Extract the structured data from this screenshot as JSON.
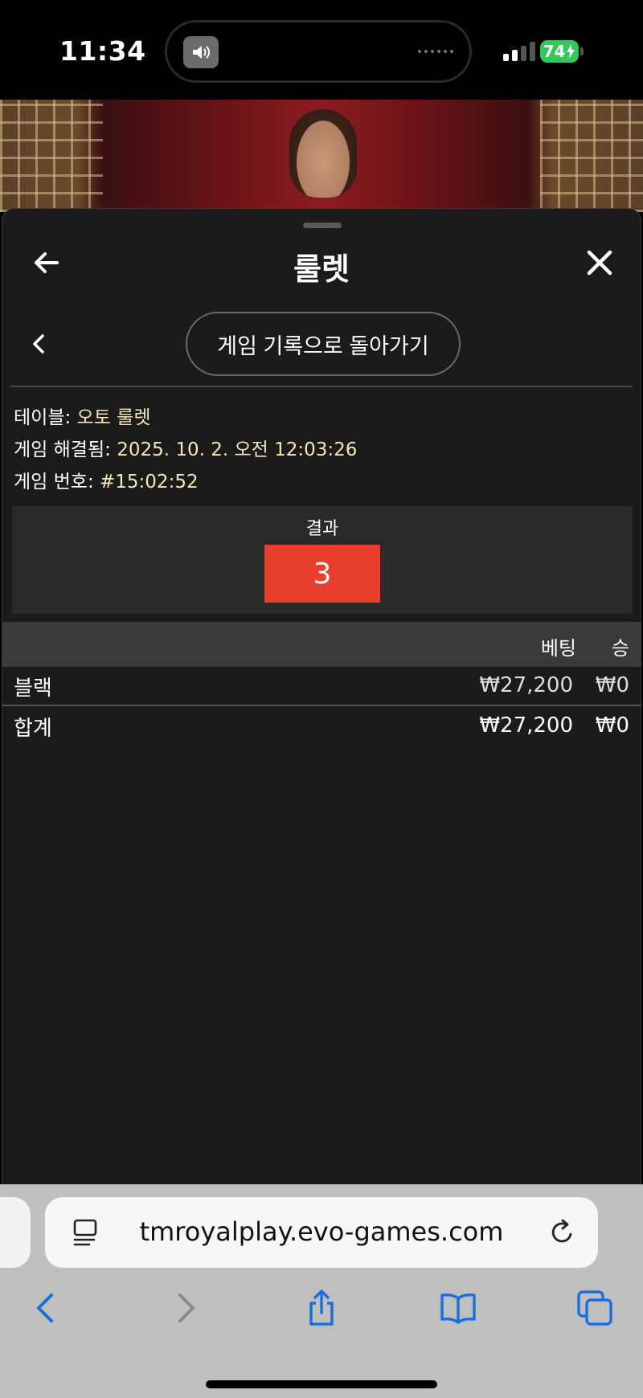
{
  "status_bar": {
    "time": "11:34",
    "battery": "74",
    "icons": [
      "speaker-icon",
      "signal-icon",
      "battery-charging-icon"
    ]
  },
  "header": {
    "title": "룰렛",
    "icons": [
      "back-arrow-icon",
      "close-icon"
    ]
  },
  "sub_nav": {
    "history_button": "게임 기록으로 돌아가기",
    "icons": [
      "chevron-left-icon"
    ]
  },
  "info": {
    "table_label": "테이블:",
    "table_value": "오토 룰렛",
    "resolved_label": "게임 해결됨:",
    "resolved_value": "2025. 10. 2. 오전 12:03:26",
    "game_no_label": "게임 번호:",
    "game_no_value": "#15:02:52"
  },
  "result": {
    "label": "결과",
    "number": "3",
    "color": "#e83e2e"
  },
  "table": {
    "col_bet": "베팅",
    "col_win": "승",
    "rows": [
      {
        "name": "블랙",
        "bet": "₩27,200",
        "win": "₩0"
      }
    ],
    "total": {
      "name": "합계",
      "bet": "₩27,200",
      "win": "₩0"
    }
  },
  "browser": {
    "url": "tmroyalplay.evo-games.com",
    "icons": [
      "reader-icon",
      "reload-icon",
      "back-icon",
      "forward-icon",
      "share-icon",
      "bookmarks-icon",
      "tabs-icon"
    ],
    "accent": "#1a6fe0"
  }
}
